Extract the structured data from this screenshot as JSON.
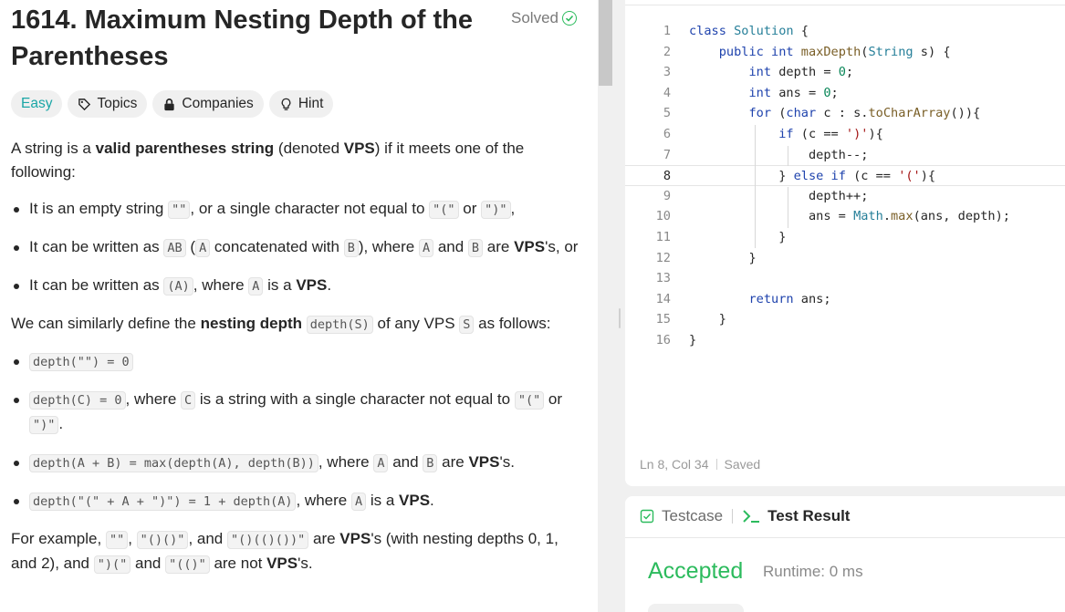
{
  "problem": {
    "title": "1614. Maximum Nesting Depth of the Parentheses",
    "status": "Solved",
    "chips": {
      "difficulty": "Easy",
      "topics": "Topics",
      "companies": "Companies",
      "hint": "Hint"
    },
    "intro_1": "A string is a ",
    "intro_vps_term": "valid parentheses string",
    "intro_2": " (denoted ",
    "intro_vps": "VPS",
    "intro_3": ") if it meets one of the following:",
    "rule1": {
      "a": "It is an empty string ",
      "code_empty": "\"\"",
      "b": ", or a single character not equal to ",
      "code_open": "\"(\"",
      "c": " or ",
      "code_close": "\")\"",
      "d": ","
    },
    "rule2": {
      "a": "It can be written as ",
      "code_ab": "AB",
      "b": " (",
      "code_a": "A",
      "c": " concatenated with ",
      "code_b": "B",
      "d": "), where ",
      "code_a2": "A",
      "e": " and ",
      "code_b2": "B",
      "f": " are ",
      "vps": "VPS",
      "g": "'s, or"
    },
    "rule3": {
      "a": "It can be written as ",
      "code_pa": "(A)",
      "b": ", where ",
      "code_a": "A",
      "c": " is a ",
      "vps": "VPS",
      "d": "."
    },
    "depth_intro": {
      "a": "We can similarly define the ",
      "term": "nesting depth",
      "b": " ",
      "code_depth": "depth(S)",
      "c": " of any VPS ",
      "code_s": "S",
      "d": " as follows:"
    },
    "depth_rule1": {
      "code": "depth(\"\") = 0"
    },
    "depth_rule2": {
      "code": "depth(C) = 0",
      "a": ", where ",
      "code_c": "C",
      "b": " is a string with a single character not equal to ",
      "code_open": "\"(\"",
      "c": " or ",
      "code_close": "\")\"",
      "d": "."
    },
    "depth_rule3": {
      "code": "depth(A + B) = max(depth(A), depth(B))",
      "a": ", where ",
      "code_a": "A",
      "b": " and ",
      "code_b": "B",
      "c": " are ",
      "vps": "VPS",
      "d": "'s."
    },
    "depth_rule4": {
      "code": "depth(\"(\" + A + \")\") = 1 + depth(A)",
      "a": ", where ",
      "code_a": "A",
      "b": " is a ",
      "vps": "VPS",
      "c": "."
    },
    "example": {
      "a": "For example, ",
      "c1": "\"\"",
      "s1": ", ",
      "c2": "\"()()\"",
      "s2": ", and ",
      "c3": "\"()(()())\"",
      "b": " are ",
      "vps": "VPS",
      "c": "'s (with nesting depths 0, 1, and 2), and ",
      "c4": "\")(\"",
      "d": " and ",
      "c5": "\"(()\"",
      "e": " are not ",
      "vps2": "VPS",
      "f": "'s."
    }
  },
  "editor": {
    "line_numbers": [
      "1",
      "2",
      "3",
      "4",
      "5",
      "6",
      "7",
      "8",
      "9",
      "10",
      "11",
      "12",
      "13",
      "14",
      "15",
      "16"
    ],
    "status_position": "Ln 8, Col 34",
    "status_saved": "Saved"
  },
  "result": {
    "tab_testcase": "Testcase",
    "tab_result": "Test Result",
    "verdict": "Accepted",
    "runtime": "Runtime: 0 ms"
  },
  "colors": {
    "accent_green": "#2cbb5d",
    "easy_teal": "#1aa6a6"
  }
}
